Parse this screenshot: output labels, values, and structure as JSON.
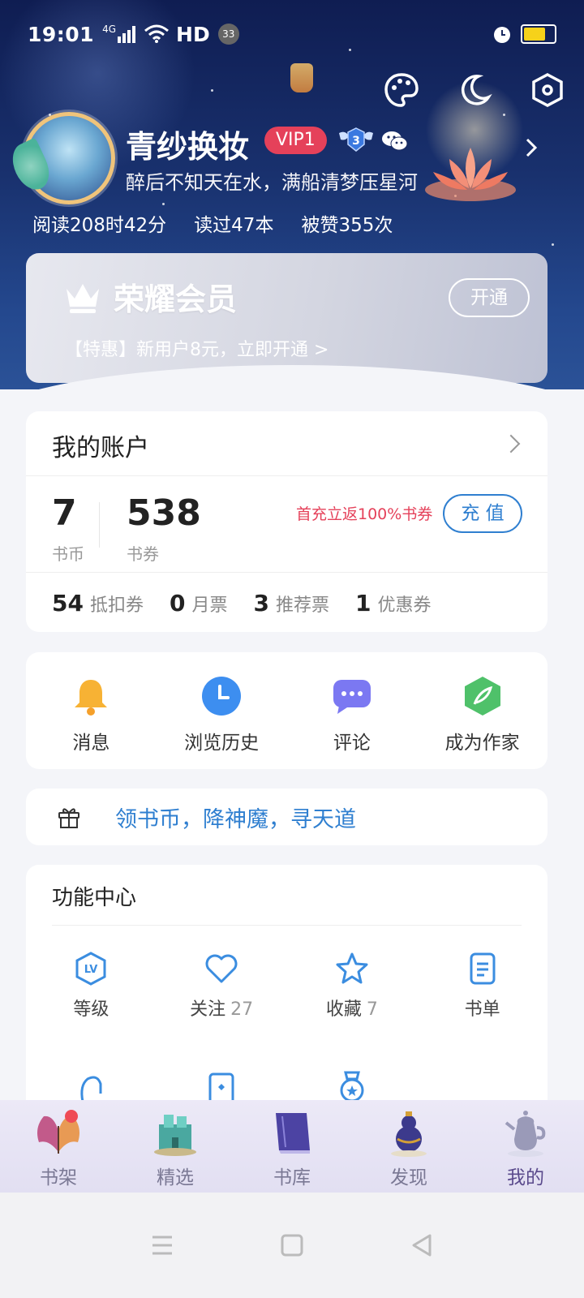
{
  "status_bar": {
    "time": "19:01",
    "network": "4G",
    "hd": "HD",
    "notification_count": "33"
  },
  "profile": {
    "username": "青纱换妆",
    "vip_badge": "VIP1",
    "level": "3",
    "motto": "醉后不知天在水，满船清梦压星河",
    "stats": [
      "阅读208时42分",
      "读过47本",
      "被赞355次"
    ]
  },
  "membership": {
    "title": "荣耀会员",
    "open_label": "开通",
    "promo": "【特惠】新用户8元，立即开通 >"
  },
  "account": {
    "title": "我的账户",
    "coins": {
      "value": "7",
      "label": "书币"
    },
    "vouchers": {
      "value": "538",
      "label": "书券"
    },
    "recharge_promo": "首充立返100%书券",
    "recharge_label": "充 值",
    "tickets": [
      {
        "count": "54",
        "label": "抵扣券"
      },
      {
        "count": "0",
        "label": "月票"
      },
      {
        "count": "3",
        "label": "推荐票"
      },
      {
        "count": "1",
        "label": "优惠券"
      }
    ]
  },
  "quick_actions": [
    {
      "label": "消息",
      "icon": "bell-icon",
      "color": "#f7b234"
    },
    {
      "label": "浏览历史",
      "icon": "clock-icon",
      "color": "#3d8ef0"
    },
    {
      "label": "评论",
      "icon": "comment-icon",
      "color": "#7b78f2"
    },
    {
      "label": "成为作家",
      "icon": "feather-icon",
      "color": "#4fc16a"
    }
  ],
  "promo_banner": {
    "text": "领书币，降神魔，寻天道",
    "icon": "gift-icon"
  },
  "function_center": {
    "title": "功能中心",
    "items": [
      {
        "label": "等级",
        "count": "",
        "icon": "level-icon"
      },
      {
        "label": "关注",
        "count": "27",
        "icon": "heart-icon"
      },
      {
        "label": "收藏",
        "count": "7",
        "icon": "star-icon"
      },
      {
        "label": "书单",
        "count": "",
        "icon": "booklist-icon"
      }
    ]
  },
  "tabs": [
    {
      "label": "书架",
      "icon": "butterfly-icon"
    },
    {
      "label": "精选",
      "icon": "castle-icon"
    },
    {
      "label": "书库",
      "icon": "book-icon"
    },
    {
      "label": "发现",
      "icon": "gourd-icon"
    },
    {
      "label": "我的",
      "icon": "teapot-icon",
      "active": true
    }
  ],
  "colors": {
    "accent": "#2f7fd0",
    "vip_red": "#e5415a",
    "header_bg": "#19316e"
  }
}
